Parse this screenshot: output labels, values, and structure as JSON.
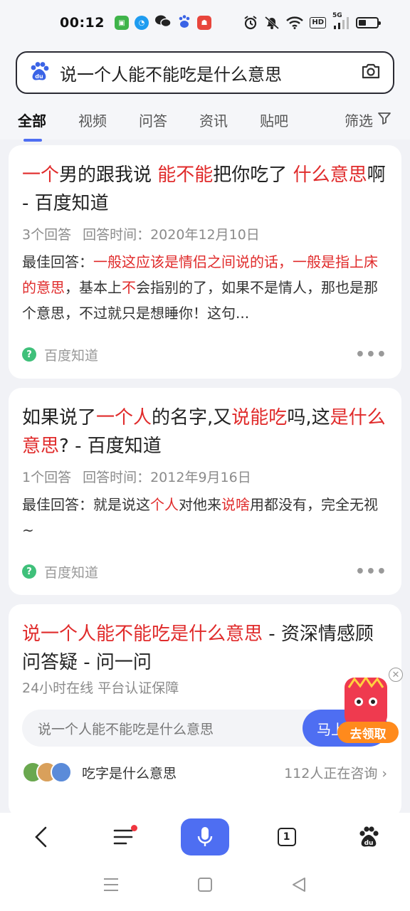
{
  "status_bar": {
    "time": "00:12",
    "network": "5G",
    "hd": "HD",
    "colors": {
      "app1": "#3fb44a",
      "app2": "#1e9cf0",
      "app4": "#3a63e6",
      "app5": "#e8453c"
    }
  },
  "search": {
    "query": "说一个人能不能吃是什么意思"
  },
  "tabs": [
    {
      "label": "全部",
      "active": true
    },
    {
      "label": "视频"
    },
    {
      "label": "问答"
    },
    {
      "label": "资讯"
    },
    {
      "label": "贴吧"
    }
  ],
  "filter_label": "筛选",
  "results": [
    {
      "title_parts": [
        {
          "t": "一个",
          "hl": true
        },
        {
          "t": "男的跟我说 "
        },
        {
          "t": "能不能",
          "hl": true
        },
        {
          "t": "把你吃了 "
        },
        {
          "t": "什么意思",
          "hl": true
        },
        {
          "t": "啊 - 百度知道"
        }
      ],
      "answers": "3个回答",
      "answer_time": "回答时间：2020年12月10日",
      "snippet_parts": [
        {
          "t": "最佳回答："
        },
        {
          "t": "一般这应该是情侣之间说的话，一般是指上床的意思",
          "hl": true
        },
        {
          "t": "，基本上"
        },
        {
          "t": "不",
          "hl": true
        },
        {
          "t": "会指别的了，如果不是情人，那也是那个意思，不过就只是想睡你！这句..."
        }
      ],
      "source": "百度知道"
    },
    {
      "title_parts": [
        {
          "t": "如果说了"
        },
        {
          "t": "一个人",
          "hl": true
        },
        {
          "t": "的名字,又"
        },
        {
          "t": "说能吃",
          "hl": true
        },
        {
          "t": "吗,这"
        },
        {
          "t": "是什么意思",
          "hl": true
        },
        {
          "t": "? - 百度知道"
        }
      ],
      "answers": "1个回答",
      "answer_time": "回答时间：2012年9月16日",
      "snippet_parts": [
        {
          "t": "最佳回答：就是说这"
        },
        {
          "t": "个人",
          "hl": true
        },
        {
          "t": "对他来"
        },
        {
          "t": "说啥",
          "hl": true
        },
        {
          "t": "用都没有，完全无视~"
        }
      ],
      "source": "百度知道"
    }
  ],
  "ask_card": {
    "title_parts": [
      {
        "t": "说一个人能不能吃是什么意思",
        "hl": true
      },
      {
        "t": " - 资深情感顾问答疑 - 问一问"
      }
    ],
    "subtitle": "24小时在线 平台认证保障",
    "input_text": "说一个人能不能吃是什么意思",
    "button_label": "马上提问",
    "related_question": "吃字是什么意思",
    "consult_count": "112人正在咨询"
  },
  "promo": {
    "label": "去领取"
  },
  "toolbar": {
    "tab_count": "1"
  }
}
